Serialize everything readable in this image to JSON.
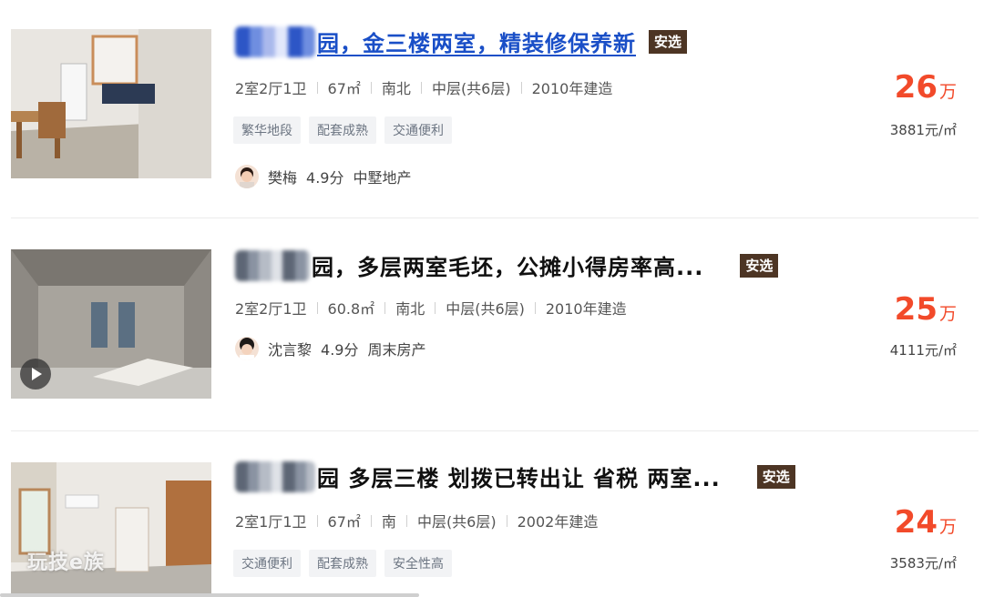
{
  "listings": [
    {
      "title": "园，金三楼两室，精装修保养新",
      "badge": "安选",
      "meta": [
        "2室2厅1卫",
        "67㎡",
        "南北",
        "中层(共6层)",
        "2010年建造"
      ],
      "tags": [
        "繁华地段",
        "配套成熟",
        "交通便利"
      ],
      "agent": {
        "name": "樊梅",
        "rating": "4.9分",
        "company": "中墅地产"
      },
      "price": "26",
      "price_unit": "万",
      "unit_price": "3881元/㎡"
    },
    {
      "title": "园，多层两室毛坯，公摊小得房率高...",
      "badge": "安选",
      "meta": [
        "2室2厅1卫",
        "60.8㎡",
        "南北",
        "中层(共6层)",
        "2010年建造"
      ],
      "tags": [],
      "agent": {
        "name": "沈言黎",
        "rating": "4.9分",
        "company": "周末房产"
      },
      "price": "25",
      "price_unit": "万",
      "unit_price": "4111元/㎡"
    },
    {
      "title": "园 多层三楼 划拨已转出让 省税 两室...",
      "badge": "安选",
      "meta": [
        "2室1厅1卫",
        "67㎡",
        "南",
        "中层(共6层)",
        "2002年建造"
      ],
      "tags": [
        "交通便利",
        "配套成熟",
        "安全性高"
      ],
      "agent": null,
      "price": "24",
      "price_unit": "万",
      "unit_price": "3583元/㎡",
      "watermark": "玩技e族"
    }
  ],
  "colors": {
    "price": "#f24a2a",
    "badge_bg": "#4d3524",
    "link": "#1a4fc7",
    "tag_bg": "#f2f3f5"
  },
  "icons": {
    "video": "play-icon"
  }
}
